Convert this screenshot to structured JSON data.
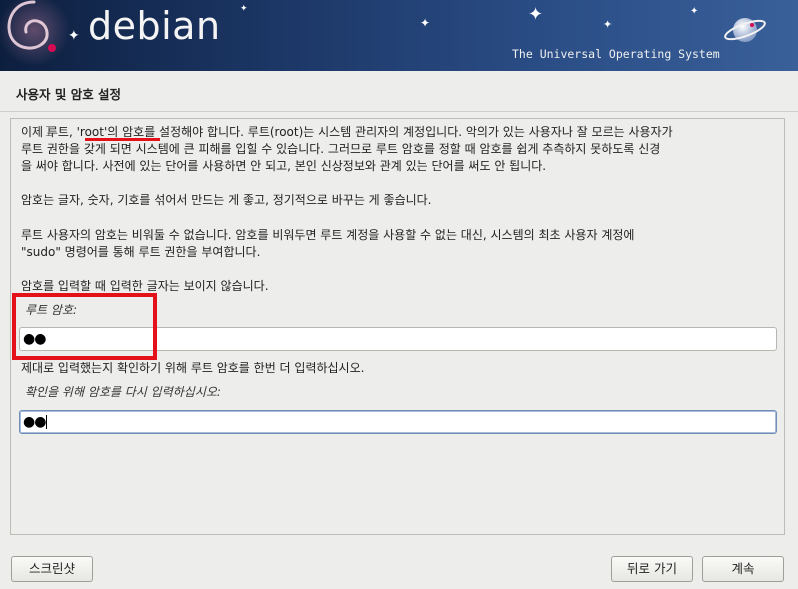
{
  "banner": {
    "logo_text": "debian",
    "tagline": "The Universal Operating System"
  },
  "page_title": "사용자 및 암호 설정",
  "instructions": {
    "p1_line1": "이제 루트, 'root'의 암호를 설정해야 합니다. 루트(root)는 시스템 관리자의 계정입니다. 악의가 있는 사용자나 잘 모르는 사용자가",
    "p1_line2": "루트 권한을 갖게 되면 시스템에 큰 피해를 입힐 수 있습니다. 그러므로 루트 암호를 정할 때 암호를 쉽게 추측하지 못하도록 신경",
    "p1_line3": "을 써야 합니다. 사전에 있는 단어를 사용하면 안 되고, 본인 신상정보와 관계 있는 단어를 써도 안 됩니다.",
    "p2": "암호는 글자, 숫자, 기호를 섞어서 만드는 게 좋고, 정기적으로 바꾸는 게 좋습니다.",
    "p3_line1": "루트 사용자의 암호는 비워둘 수 없습니다. 암호를 비워두면 루트 계정을 사용할 수 없는 대신, 시스템의 최초 사용자 계정에",
    "p3_line2": "\"sudo\" 명령어를 통해 루트 권한을 부여합니다.",
    "p4": "암호를 입력할 때 입력한 글자는 보이지 않습니다."
  },
  "root_password": {
    "label": "루트 암호:",
    "value": "●●"
  },
  "confirm_instruction": "제대로 입력했는지 확인하기 위해 루트 암호를 한번 더 입력하십시오.",
  "confirm_password": {
    "label": "확인을 위해 암호를 다시 입력하십시오:",
    "value": "●●"
  },
  "buttons": {
    "screenshot": "스크린샷",
    "back": "뒤로 가기",
    "continue": "계속"
  },
  "colors": {
    "banner_dark": "#0d1f3f",
    "banner_light": "#3a6099",
    "debian_red": "#d70a53",
    "annotation_red": "#e4101a",
    "window_bg": "#ededeb"
  },
  "icons": {
    "swirl": "debian-swirl-icon",
    "planet": "ringed-planet-icon",
    "cursor": "text-cursor-icon"
  }
}
